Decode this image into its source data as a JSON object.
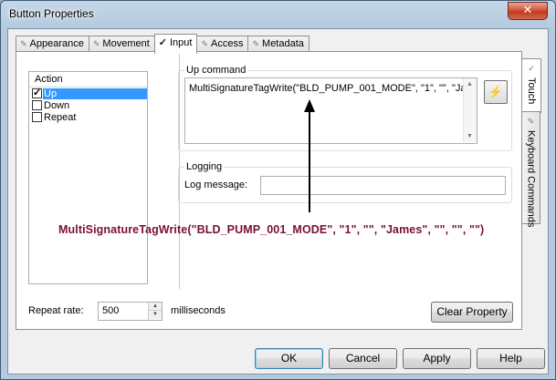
{
  "window": {
    "title": "Button Properties",
    "close_glyph": "✕"
  },
  "tabs": [
    {
      "label": "Appearance",
      "icon": "pencil-icon",
      "glyph": "✎",
      "active": false
    },
    {
      "label": "Movement",
      "icon": "pencil-icon",
      "glyph": "✎",
      "active": false
    },
    {
      "label": "Input",
      "icon": "check-icon",
      "glyph": "✓",
      "active": true
    },
    {
      "label": "Access",
      "icon": "pencil-icon",
      "glyph": "✎",
      "active": false
    },
    {
      "label": "Metadata",
      "icon": "pencil-icon",
      "glyph": "✎",
      "active": false
    }
  ],
  "side_tabs": [
    {
      "label": "Touch",
      "glyph": "✓",
      "active": true
    },
    {
      "label": "Keyboard Commands",
      "glyph": "✎",
      "active": false
    }
  ],
  "action_list": {
    "header": "Action",
    "items": [
      {
        "label": "Up",
        "checked": true,
        "selected": true
      },
      {
        "label": "Down",
        "checked": false,
        "selected": false
      },
      {
        "label": "Repeat",
        "checked": false,
        "selected": false
      }
    ]
  },
  "up_command": {
    "title": "Up command",
    "value": "MultiSignatureTagWrite(\"BLD_PUMP_001_MODE\", \"1\", \"\", \"James\", \"\", \"\", \"\")",
    "wand_glyph": "⚡"
  },
  "logging": {
    "title": "Logging",
    "label": "Log message:",
    "value": ""
  },
  "annotation": {
    "text": "MultiSignatureTagWrite(\"BLD_PUMP_001_MODE\", \"1\", \"\", \"James\", \"\", \"\", \"\")"
  },
  "repeat": {
    "label": "Repeat rate:",
    "value": "500",
    "unit": "milliseconds"
  },
  "buttons": {
    "clear": "Clear Property",
    "ok": "OK",
    "cancel": "Cancel",
    "apply": "Apply",
    "help": "Help"
  }
}
